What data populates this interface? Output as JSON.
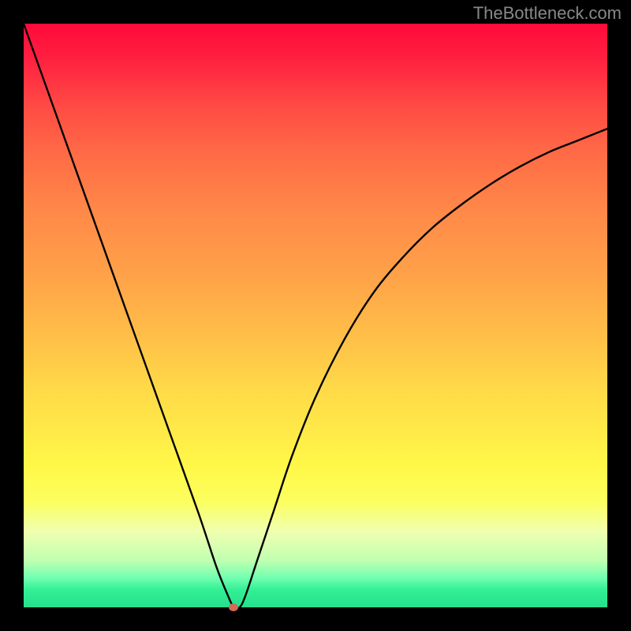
{
  "watermark": "TheBottleneck.com",
  "colors": {
    "background": "#000000",
    "curve": "#000000",
    "dot": "#d46a5a",
    "gradient_top": "#ff0a3a",
    "gradient_bottom": "#26e08c"
  },
  "chart_data": {
    "type": "line",
    "title": "",
    "xlabel": "",
    "ylabel": "",
    "xlim": [
      0,
      100
    ],
    "ylim": [
      0,
      100
    ],
    "grid": false,
    "legend": false,
    "annotations": [
      {
        "type": "gradient_background",
        "direction": "vertical",
        "colors": [
          "red",
          "orange",
          "yellow",
          "green"
        ],
        "meaning": "red=bad, green=optimal"
      },
      {
        "type": "marker",
        "x": 36,
        "y": 0,
        "shape": "oval",
        "color": "#d46a5a",
        "meaning": "minimum / optimal point"
      }
    ],
    "series": [
      {
        "name": "curve",
        "x": [
          0,
          5,
          10,
          15,
          20,
          25,
          30,
          33,
          35,
          36,
          37,
          38,
          40,
          43,
          46,
          50,
          55,
          60,
          65,
          70,
          75,
          80,
          85,
          90,
          95,
          100
        ],
        "y": [
          100,
          86,
          72,
          58,
          44,
          30,
          16,
          7,
          2,
          0,
          0,
          2,
          8,
          17,
          26,
          36,
          46,
          54,
          60,
          65,
          69,
          72.5,
          75.5,
          78,
          80,
          82
        ]
      }
    ]
  }
}
